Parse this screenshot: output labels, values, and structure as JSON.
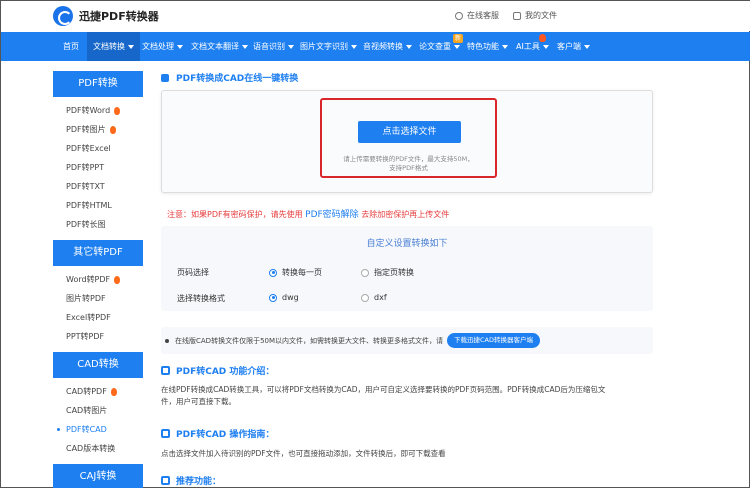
{
  "header": {
    "brand": "迅捷PDF转换器",
    "links": [
      "在线客服",
      "我的文件"
    ]
  },
  "nav": {
    "items": [
      "首页",
      "文档转换",
      "文档处理",
      "文档文本翻译",
      "语音识别",
      "图片文字识别",
      "音视频转换",
      "论文查重",
      "特色功能",
      "AI工具",
      "客户端"
    ],
    "badge_new": "新"
  },
  "sidebar": {
    "groups": [
      {
        "title": "PDF转换",
        "items": [
          "PDF转Word",
          "PDF转图片",
          "PDF转Excel",
          "PDF转PPT",
          "PDF转TXT",
          "PDF转HTML",
          "PDF转长图"
        ]
      },
      {
        "title": "其它转PDF",
        "items": [
          "Word转PDF",
          "图片转PDF",
          "Excel转PDF",
          "PPT转PDF"
        ]
      },
      {
        "title": "CAD转换",
        "items": [
          "CAD转PDF",
          "CAD转图片",
          "PDF转CAD",
          "CAD版本转换"
        ]
      },
      {
        "title": "CAJ转换",
        "items": []
      }
    ]
  },
  "main": {
    "page_title": "PDF转换成CAD在线一键转换",
    "upload": {
      "button": "点击选择文件",
      "hint_line1": "请上传需要转换的PDF文件，最大支持50M，",
      "hint_line2": "支持PDF格式"
    },
    "notice": {
      "prefix": "注意：如果PDF有密码保护，请先使用",
      "link": "PDF密码解除",
      "suffix": "去除加密保护再上传文件"
    },
    "settings": {
      "title": "自定义设置转换如下",
      "page_label": "页码选择",
      "page_opt1": "转换每一页",
      "page_opt2": "指定页转换",
      "format_label": "选择转换格式",
      "format_opt1": "dwg",
      "format_opt2": "dxf"
    },
    "limit": {
      "text": "在线版CAD转换文件仅限于50M以内文件，如需转换更大文件、转换更多格式文件，请",
      "button": "下载迅捷CAD转换器客户端"
    },
    "intro": {
      "title": "PDF转CAD 功能介绍：",
      "line1": "在线PDF转换成CAD转换工具，可以将PDF文档转换为CAD，用户可自定义选择要转换的PDF页码范围。PDF转换成CAD后为压缩包文",
      "line2": "件，用户可直接下载。"
    },
    "guide": {
      "title": "PDF转CAD 操作指南：",
      "line1": "点击选择文件加入待识别的PDF文件，也可直接拖动添加，文件转换后，即可下载查看"
    },
    "recommend": {
      "title": "推荐功能："
    }
  }
}
